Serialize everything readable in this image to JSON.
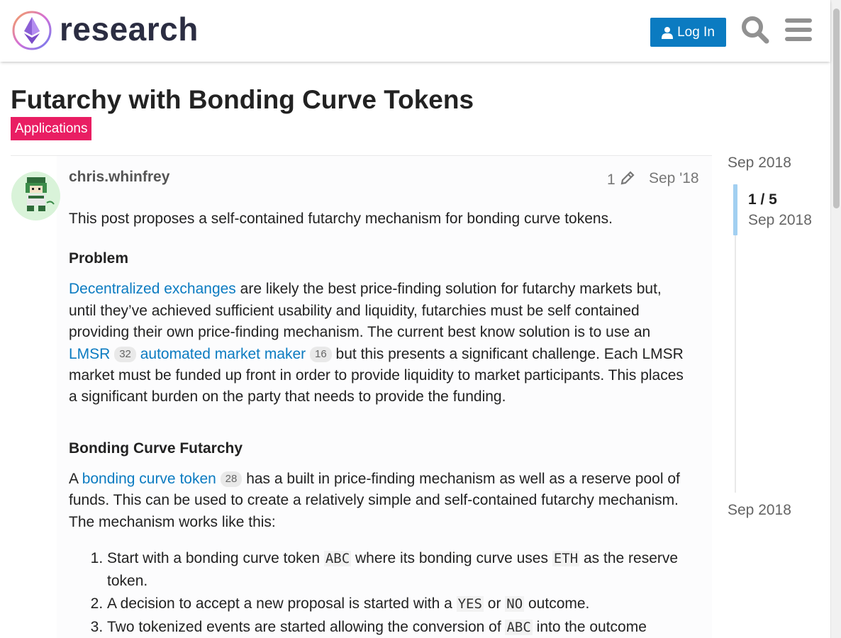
{
  "header": {
    "logo_text": "research",
    "login_label": "Log In"
  },
  "topic": {
    "title": "Futarchy with Bonding Curve Tokens",
    "category": "Applications",
    "category_color": "#e91e63"
  },
  "post": {
    "author": "chris.whinfrey",
    "edit_count": "1",
    "date": "Sep '18",
    "intro": "This post proposes a self-contained futarchy mechanism for bonding curve tokens.",
    "h_problem": "Problem",
    "p2_link": "Decentralized exchanges",
    "p2_text": " are likely the best price-finding solution for futarchy markets but, until they’ve achieved sufficient usability and liquidity, futarchies must be self contained providing their own price-finding mechanism. The current best know solution is to use an ",
    "link_lmsr": "LMSR",
    "badge_lmsr": "32",
    "link_amm": "automated market maker",
    "badge_amm": "16",
    "p2_tail": " but this presents a significant challenge. Each LMSR market must be funded up front in order to provide liquidity to market participants. This places a significant burden on the party that needs to provide the funding.",
    "h_bcf": "Bonding Curve Futarchy",
    "p3_pre": "A ",
    "link_bct": "bonding curve token",
    "badge_bct": "28",
    "p3_text": " has a built in price-finding mechanism as well as a reserve pool of funds. This can be used to create a relatively simple and self-contained futarchy mechanism. The mechanism works like this:",
    "li1_a": "Start with a bonding curve token ",
    "code_abc": "ABC",
    "li1_b": " where its bonding curve uses ",
    "code_eth": "ETH",
    "li1_c": " as the reserve token.",
    "li2_a": "A decision to accept a new proposal is started with a ",
    "code_yes": "YES",
    "li2_b": " or ",
    "code_no": "NO",
    "li2_c": " outcome.",
    "li3_a": "Two tokenized events are started allowing the conversion of ",
    "li3_b": " into the outcome"
  },
  "timeline": {
    "top_date": "Sep 2018",
    "position": "1 / 5",
    "position_date": "Sep 2018",
    "bottom_date": "Sep 2018"
  },
  "colors": {
    "link": "#0b7bc1",
    "button": "#0b7bc1",
    "timeline_handle": "#a2cff1"
  }
}
